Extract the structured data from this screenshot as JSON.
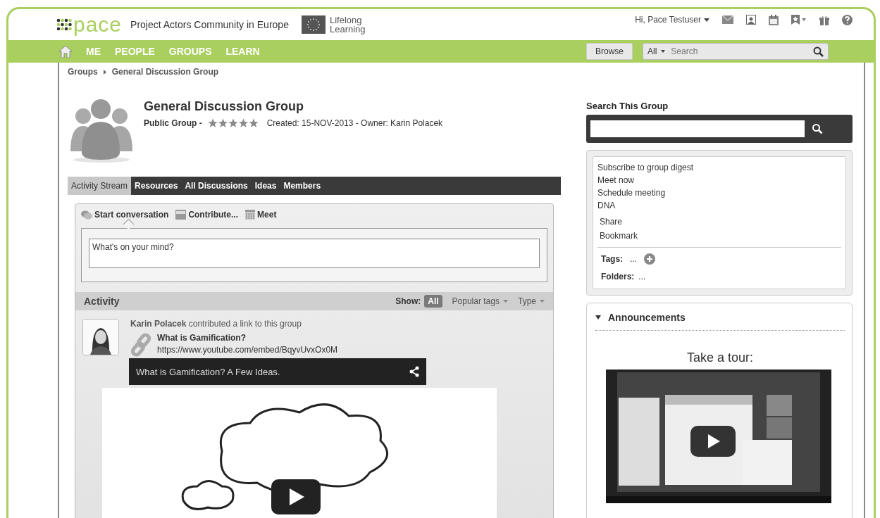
{
  "header": {
    "logo": "pace",
    "tagline": "Project Actors Community in Europe",
    "program": [
      "Lifelong",
      "Learning"
    ],
    "user_menu": "Hi, Pace Testuser"
  },
  "nav": {
    "items": [
      {
        "label": "ME",
        "selected": false
      },
      {
        "label": "PEOPLE",
        "selected": false
      },
      {
        "label": "GROUPS",
        "selected": false
      },
      {
        "label": "LEARN",
        "selected": false
      }
    ],
    "browse": "Browse",
    "scope": "All",
    "search_placeholder": "Search"
  },
  "breadcrumb": [
    "Groups",
    "General Discussion Group"
  ],
  "group": {
    "title": "General Discussion Group",
    "visibility": "Public Group -",
    "stars": 5,
    "meta": "Created: 15-NOV-2013 - Owner: Karin Polacek"
  },
  "tabs": [
    {
      "label": "Activity Stream",
      "selected": true
    },
    {
      "label": "Resources",
      "selected": false
    },
    {
      "label": "All Discussions",
      "selected": false
    },
    {
      "label": "Ideas",
      "selected": false
    },
    {
      "label": "Members",
      "selected": false
    }
  ],
  "composer": {
    "actions": [
      {
        "label": "Start conversation",
        "kind": "chat",
        "selected": true
      },
      {
        "label": "Contribute...",
        "kind": "doc",
        "selected": false
      },
      {
        "label": "Meet",
        "kind": "calendar",
        "selected": false
      }
    ],
    "placeholder": "What's on your mind?"
  },
  "activity": {
    "title": "Activity",
    "show_label": "Show:",
    "filters": [
      {
        "label": "All",
        "selected": true
      }
    ],
    "dropdowns": [
      "Popular tags",
      "Type"
    ],
    "entries": [
      {
        "author": "Karin Polacek",
        "action": "contributed a link to this group",
        "link_title": "What is Gamification?",
        "url": "https://www.youtube.com/embed/BqyvUvxOx0M",
        "video_title": "What is Gamification? A Few Ideas."
      }
    ]
  },
  "sidebar": {
    "search_title": "Search This Group",
    "actions": [
      "Subscribe to group digest",
      "Meet now",
      "Schedule meeting",
      "DNA"
    ],
    "links": [
      "Share",
      "Bookmark"
    ],
    "tags_label": "Tags:",
    "tags_value": "...",
    "folders_label": "Folders:",
    "folders_value": "...",
    "announcements": {
      "title": "Announcements",
      "expanded": true,
      "tour_title": "Take a tour:"
    }
  }
}
